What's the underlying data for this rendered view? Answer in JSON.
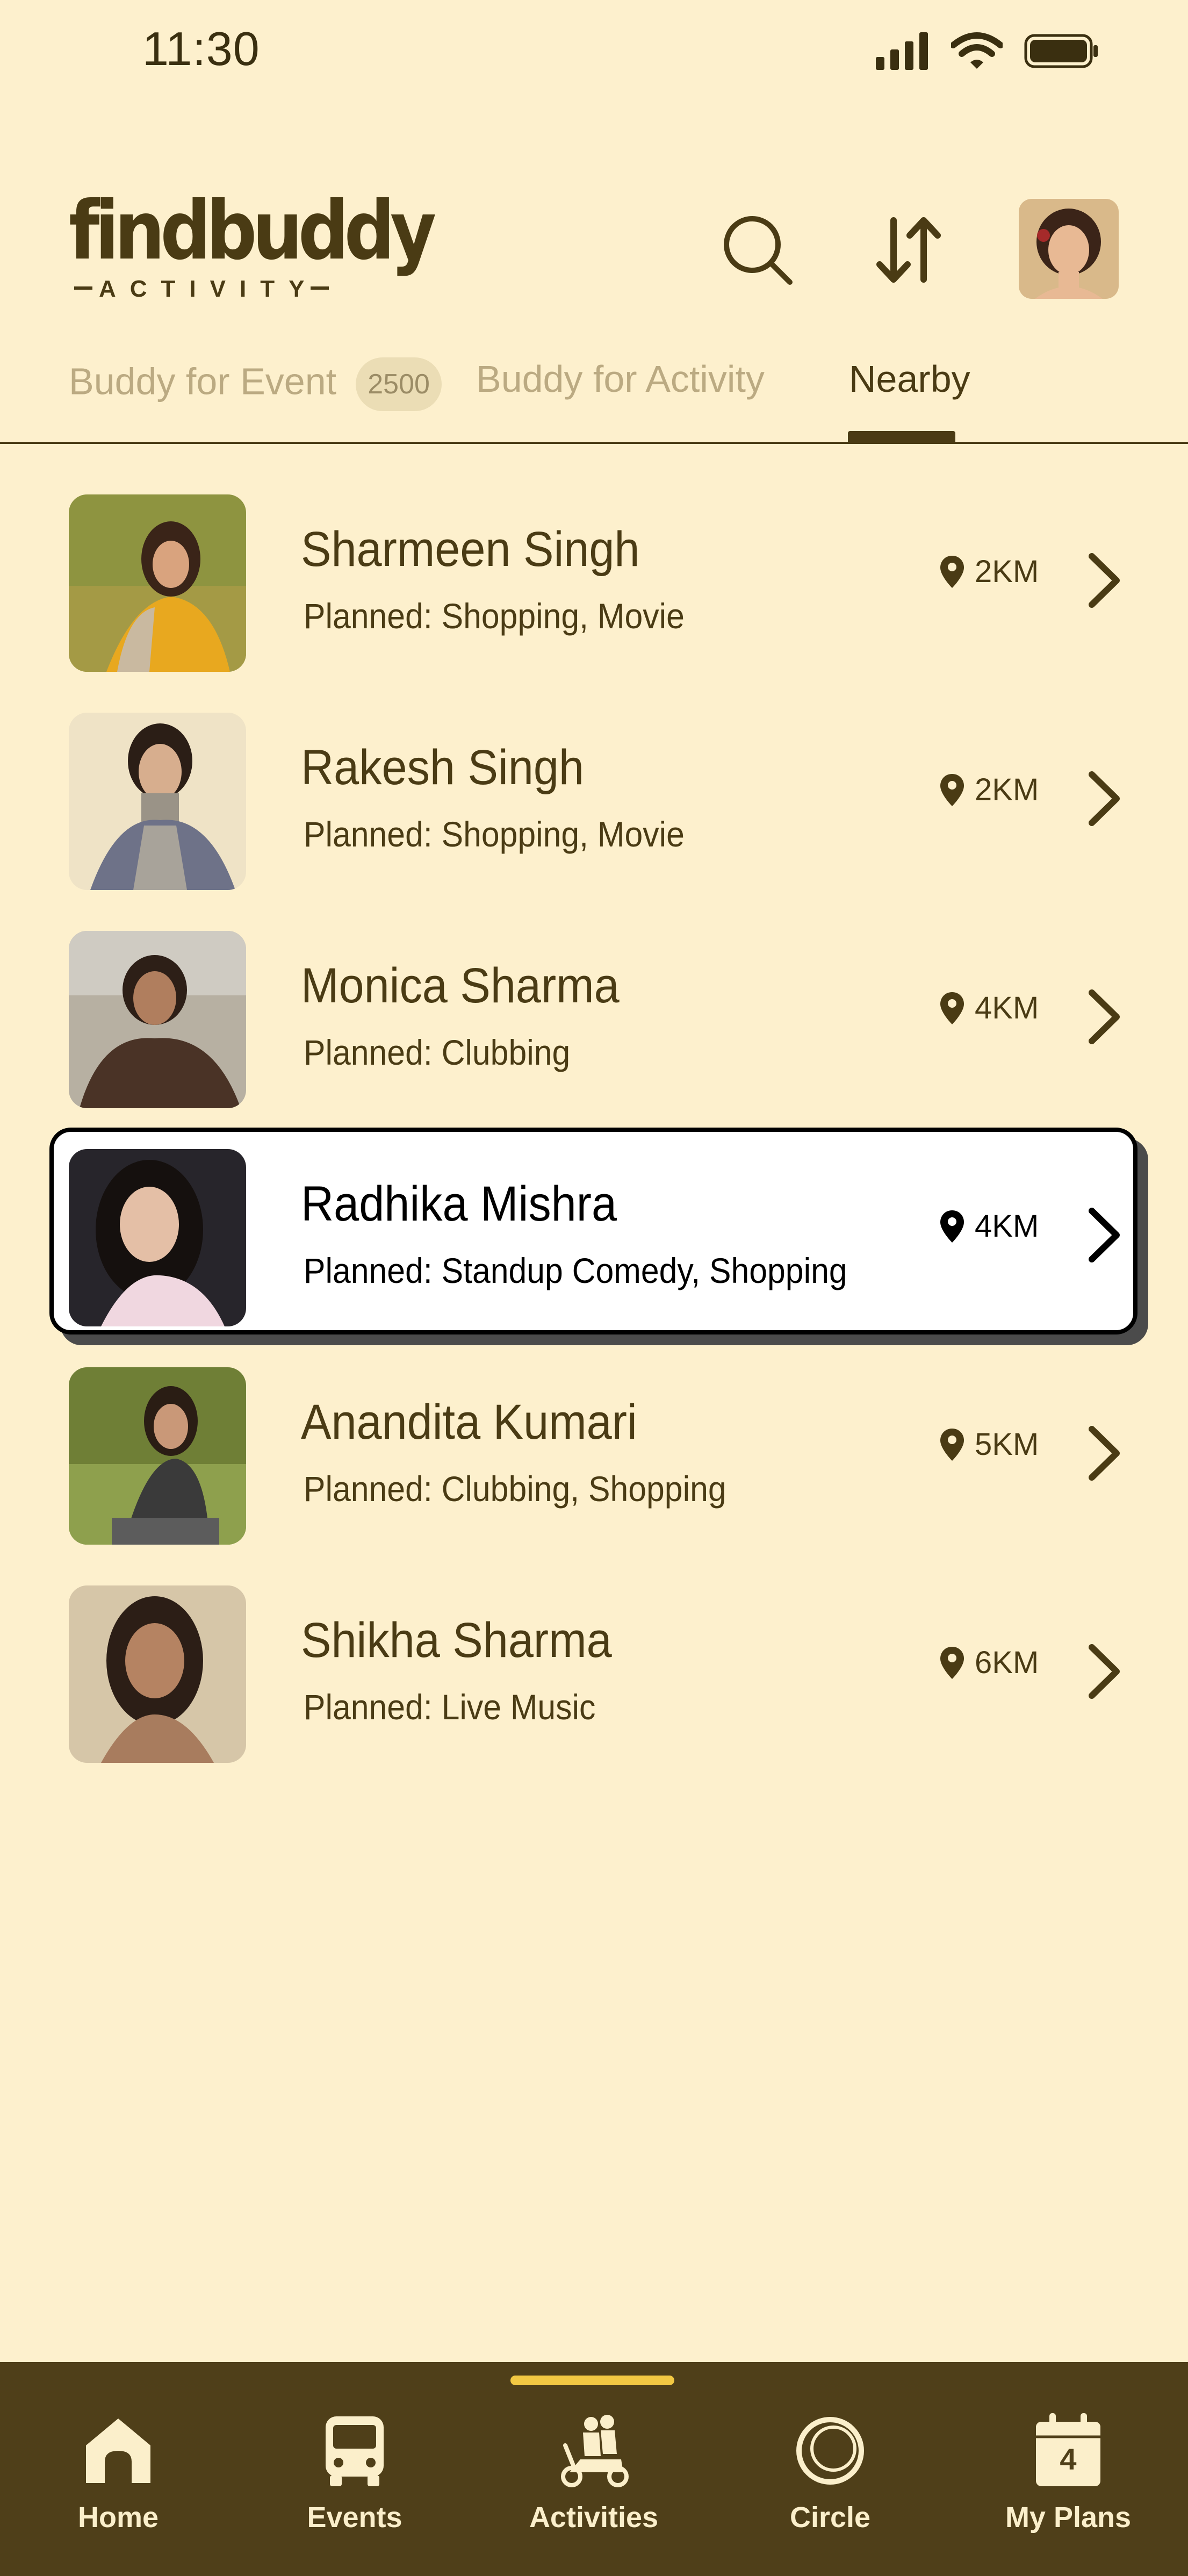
{
  "status_bar": {
    "time": "11:30"
  },
  "header": {
    "logo_main": "findbuddy",
    "logo_sub": "ACTIVITY"
  },
  "tabs": [
    {
      "label": "Buddy for Event",
      "badge": "2500"
    },
    {
      "label": "Buddy for Activity"
    },
    {
      "label": "Nearby",
      "active": true
    }
  ],
  "people": [
    {
      "name": "Sharmeen Singh",
      "planned": "Planned: Shopping, Movie",
      "distance": "2KM",
      "photo_bg": "#C9A847"
    },
    {
      "name": "Rakesh Singh",
      "planned": "Planned: Shopping, Movie",
      "distance": "2KM",
      "photo_bg": "#E3D5B4"
    },
    {
      "name": "Monica Sharma",
      "planned": "Planned: Clubbing",
      "distance": "4KM",
      "photo_bg": "#8A7A60"
    },
    {
      "name": "Radhika Mishra",
      "planned": "Planned: Standup Comedy, Shopping",
      "distance": "4KM",
      "photo_bg": "#2E2A2C",
      "selected": true
    },
    {
      "name": "Anandita Kumari",
      "planned": "Planned: Clubbing, Shopping",
      "distance": "5KM",
      "photo_bg": "#7D8B3F"
    },
    {
      "name": "Shikha Sharma",
      "planned": "Planned: Live Music",
      "distance": "6KM",
      "photo_bg": "#CBB89A"
    }
  ],
  "bottom_nav": [
    {
      "label": "Home",
      "icon": "home-icon"
    },
    {
      "label": "Events",
      "icon": "bus-icon"
    },
    {
      "label": "Activities",
      "icon": "scooter-icon",
      "active": true
    },
    {
      "label": "Circle",
      "icon": "circle-icon"
    },
    {
      "label": "My Plans",
      "icon": "calendar-icon",
      "calendar_day": "4"
    }
  ],
  "colors": {
    "background": "#FDF0CD",
    "primary": "#4A3B14",
    "nav_bg": "#4F3F19",
    "nav_indicator": "#F2C843"
  }
}
